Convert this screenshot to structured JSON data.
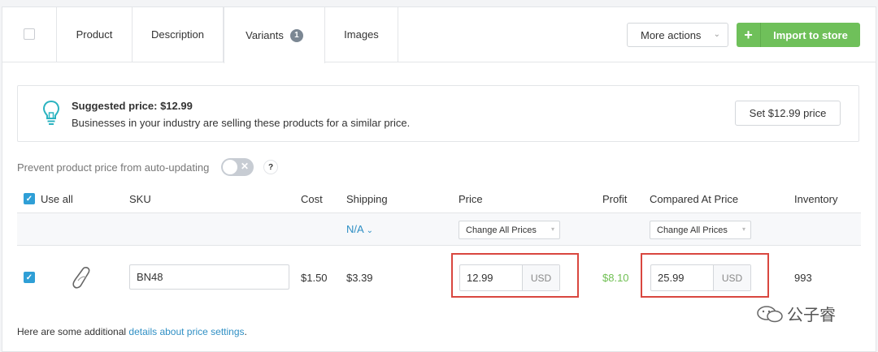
{
  "tabs": [
    {
      "label": "Product"
    },
    {
      "label": "Description"
    },
    {
      "label": "Variants",
      "badge": "1"
    },
    {
      "label": "Images"
    }
  ],
  "actions": {
    "more_actions": "More actions",
    "import_to_store": "Import to store"
  },
  "suggestion": {
    "title": "Suggested price: $12.99",
    "description": "Businesses in your industry are selling these products for a similar price.",
    "button": "Set $12.99 price"
  },
  "prevent": {
    "label": "Prevent product price from auto-updating",
    "help": "?"
  },
  "table": {
    "headers": {
      "use_all": "Use all",
      "sku": "SKU",
      "cost": "Cost",
      "shipping": "Shipping",
      "price": "Price",
      "profit": "Profit",
      "compared": "Compared At Price",
      "inventory": "Inventory"
    },
    "shipping_select": "N/A",
    "change_all_prices": "Change All Prices",
    "change_all_compared": "Change All Prices",
    "rows": [
      {
        "sku": "BN48",
        "cost": "$1.50",
        "shipping": "$3.39",
        "price": "12.99",
        "price_currency": "USD",
        "profit": "$8.10",
        "compared": "25.99",
        "compared_currency": "USD",
        "inventory": "993"
      }
    ]
  },
  "footer": {
    "text": "Here are some additional ",
    "link": "details about price settings",
    "tail": "."
  },
  "watermark": "公子睿",
  "colors": {
    "accent_green": "#6fc05a",
    "checkbox_blue": "#2f9fd6",
    "link_blue": "#2f8fc4",
    "highlight_red": "#d9473f",
    "profit_green": "#6fbf52"
  }
}
